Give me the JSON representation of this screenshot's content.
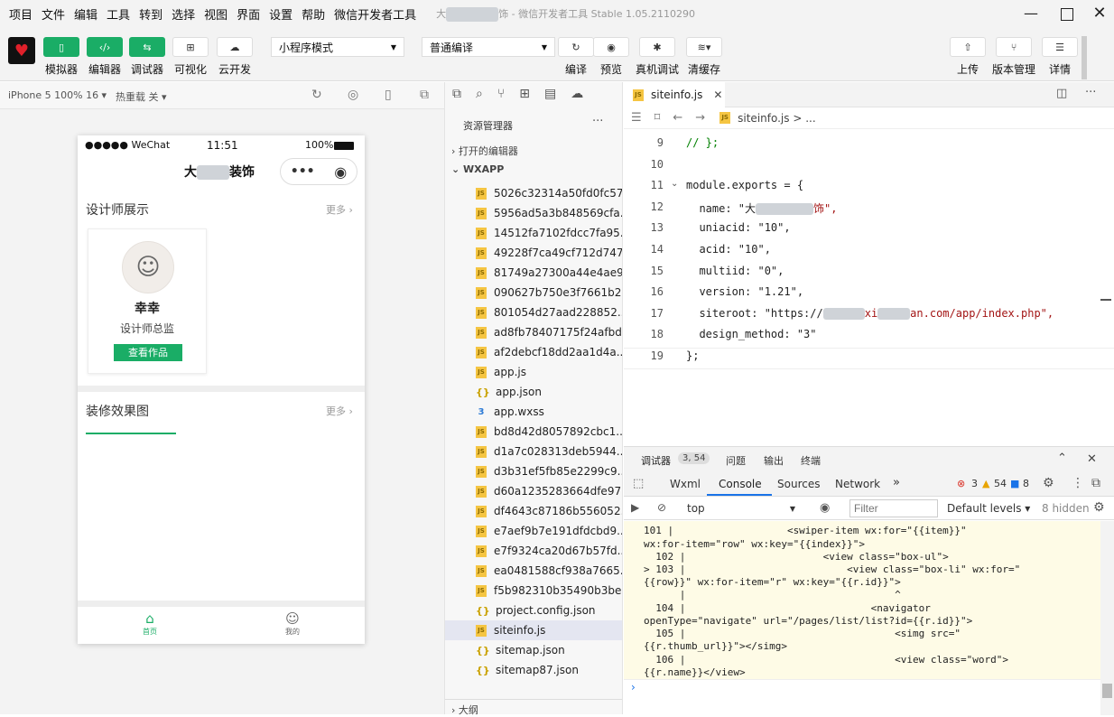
{
  "menu": [
    "项目",
    "文件",
    "编辑",
    "工具",
    "转到",
    "选择",
    "视图",
    "界面",
    "设置",
    "帮助",
    "微信开发者工具"
  ],
  "window_title": {
    "prefix": "大",
    "suffix": "饰 - 微信开发者工具 Stable 1.05.2110290"
  },
  "toolbar": {
    "simulator": "模拟器",
    "editor": "编辑器",
    "debugger": "调试器",
    "visual": "可视化",
    "cloud": "云开发",
    "mode_select": "小程序模式",
    "compile_select": "普通编译",
    "compile": "编译",
    "preview": "预览",
    "real_debug": "真机调试",
    "clear_cache": "清缓存",
    "upload": "上传",
    "version": "版本管理",
    "details": "详情"
  },
  "simbar": {
    "device": "iPhone 5 100% 16 ▾",
    "hot_reload": "热重载 关 ▾"
  },
  "phone": {
    "status_left": "●●●●● WeChat",
    "time": "11:51",
    "battery": "100%",
    "title_prefix": "大",
    "title_suffix": "装饰",
    "section1_title": "设计师展示",
    "more": "更多",
    "designer_name": "幸幸",
    "designer_role": "设计师总监",
    "view_works": "查看作品",
    "section2_title": "装修效果图",
    "tab_home": "首页",
    "tab_mine": "我的"
  },
  "explorer": {
    "header": "资源管理器",
    "open_editors": "打开的编辑器",
    "root": "WXAPP",
    "outline": "大纲",
    "files": [
      {
        "name": "5026c32314a50fd0fc57...",
        "t": "js"
      },
      {
        "name": "5956ad5a3b848569cfa...",
        "t": "js"
      },
      {
        "name": "14512fa7102fdcc7fa95...",
        "t": "js"
      },
      {
        "name": "49228f7ca49cf712d747...",
        "t": "js"
      },
      {
        "name": "81749a27300a44e4ae9...",
        "t": "js"
      },
      {
        "name": "090627b750e3f7661b2...",
        "t": "js"
      },
      {
        "name": "801054d27aad228852...",
        "t": "js"
      },
      {
        "name": "ad8fb78407175f24afbd...",
        "t": "js"
      },
      {
        "name": "af2debcf18dd2aa1d4a...",
        "t": "js"
      },
      {
        "name": "app.js",
        "t": "js"
      },
      {
        "name": "app.json",
        "t": "json"
      },
      {
        "name": "app.wxss",
        "t": "wxss"
      },
      {
        "name": "bd8d42d8057892cbc1...",
        "t": "js"
      },
      {
        "name": "d1a7c028313deb5944...",
        "t": "js"
      },
      {
        "name": "d3b31ef5fb85e2299c9...",
        "t": "js"
      },
      {
        "name": "d60a1235283664dfe97...",
        "t": "js"
      },
      {
        "name": "df4643c87186b556052...",
        "t": "js"
      },
      {
        "name": "e7aef9b7e191dfdcbd9...",
        "t": "js"
      },
      {
        "name": "e7f9324ca20d67b57fd...",
        "t": "js"
      },
      {
        "name": "ea0481588cf938a7665...",
        "t": "js"
      },
      {
        "name": "f5b982310b35490b3be...",
        "t": "js"
      },
      {
        "name": "project.config.json",
        "t": "json"
      },
      {
        "name": "siteinfo.js",
        "t": "js",
        "selected": true
      },
      {
        "name": "sitemap.json",
        "t": "json"
      },
      {
        "name": "sitemap87.json",
        "t": "json"
      }
    ]
  },
  "editor": {
    "tab": "siteinfo.js",
    "breadcrumb": "siteinfo.js > ...",
    "lines": [
      {
        "n": "9",
        "html": "cm",
        "text": "// };"
      },
      {
        "n": "10",
        "text": ""
      },
      {
        "n": "11",
        "text": "module.exports = {"
      },
      {
        "n": "12",
        "text": "  name: \"大"
      },
      {
        "n": "13",
        "text": "  uniacid: \"10\","
      },
      {
        "n": "14",
        "text": "  acid: \"10\","
      },
      {
        "n": "15",
        "text": "  multiid: \"0\","
      },
      {
        "n": "16",
        "text": "  version: \"1.21\","
      },
      {
        "n": "17",
        "text": "  siteroot: \"https://"
      },
      {
        "n": "18",
        "text": "  design_method: \"3\""
      },
      {
        "n": "19",
        "text": "};"
      }
    ],
    "name_tail": "饰\",",
    "siteroot_mid": "xi",
    "siteroot_tail": "an.com/app/index.php\","
  },
  "debugger": {
    "title": "调试器",
    "badge": "3, 54",
    "issues": "问题",
    "output": "输出",
    "terminal": "终端",
    "tabs": [
      "Wxml",
      "Console",
      "Sources",
      "Network"
    ],
    "errors": "3",
    "warnings": "54",
    "infos": "8",
    "context": "top",
    "filter_placeholder": "Filter",
    "levels": "Default levels ▾",
    "hidden": "8 hidden",
    "console_lines": [
      "101 |                   <swiper-item wx:for=\"{{item}}\"",
      "wx:for-item=\"row\" wx:key=\"{{index}}\">",
      "  102 |                       <view class=\"box-ul\">",
      "> 103 |                           <view class=\"box-li\" wx:for=\"",
      "{{row}}\" wx:for-item=\"r\" wx:key=\"{{r.id}}\">",
      "      |                                   ^",
      "  104 |                               <navigator",
      "openType=\"navigate\" url=\"/pages/list/list?id={{r.id}}\">",
      "  105 |                                   <simg src=\"",
      "{{r.thumb_url}}\"></simg>",
      "  106 |                                   <view class=\"word\">",
      "{{r.name}}</view>"
    ],
    "prompt": "›"
  }
}
